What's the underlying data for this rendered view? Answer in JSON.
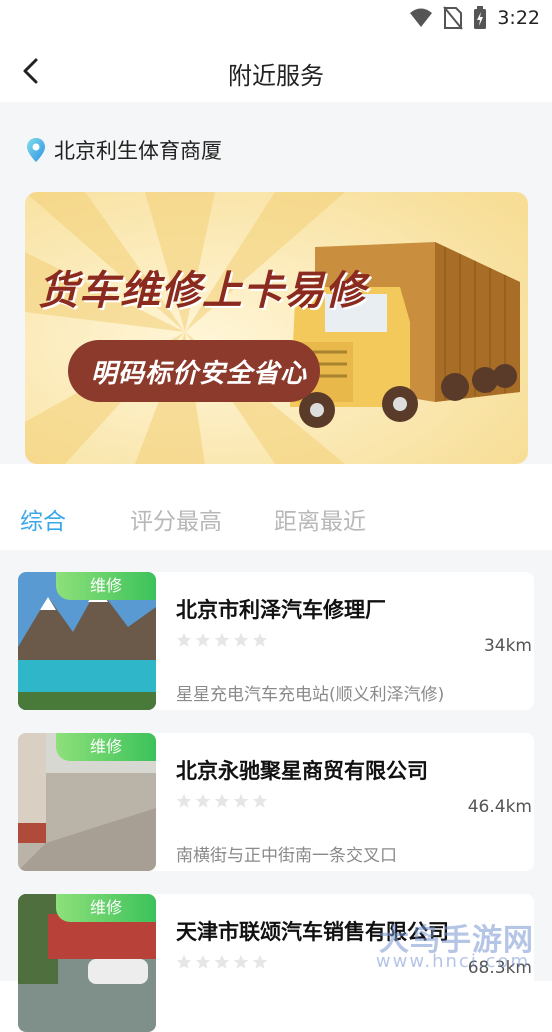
{
  "status_bar": {
    "time": "3:22"
  },
  "header": {
    "title": "附近服务"
  },
  "location": {
    "text": "北京利生体育商厦"
  },
  "banner": {
    "headline": "货车维修上卡易修",
    "subline": "明码标价安全省心"
  },
  "tabs": [
    {
      "label": "综合",
      "active": true
    },
    {
      "label": "评分最高",
      "active": false
    },
    {
      "label": "距离最近",
      "active": false
    }
  ],
  "shops": [
    {
      "badge": "维修",
      "name": "北京市利泽汽车修理厂",
      "distance": "34km",
      "address": "星星充电汽车充电站(顺义利泽汽修)",
      "rating": 0
    },
    {
      "badge": "维修",
      "name": "北京永驰聚星商贸有限公司",
      "distance": "46.4km",
      "address": "南横街与正中街南一条交叉口",
      "rating": 0
    },
    {
      "badge": "维修",
      "name": "天津市联颂汽车销售有限公司",
      "distance": "68.3km",
      "address": "",
      "rating": 0
    }
  ],
  "watermark": {
    "text": "大鸟手游网",
    "url": "www.hnci.com"
  },
  "colors": {
    "accent": "#3aa7e8",
    "badge_green": "#3cc25a",
    "banner_red": "#8b3a2b",
    "banner_yellow": "#f6d57a"
  }
}
